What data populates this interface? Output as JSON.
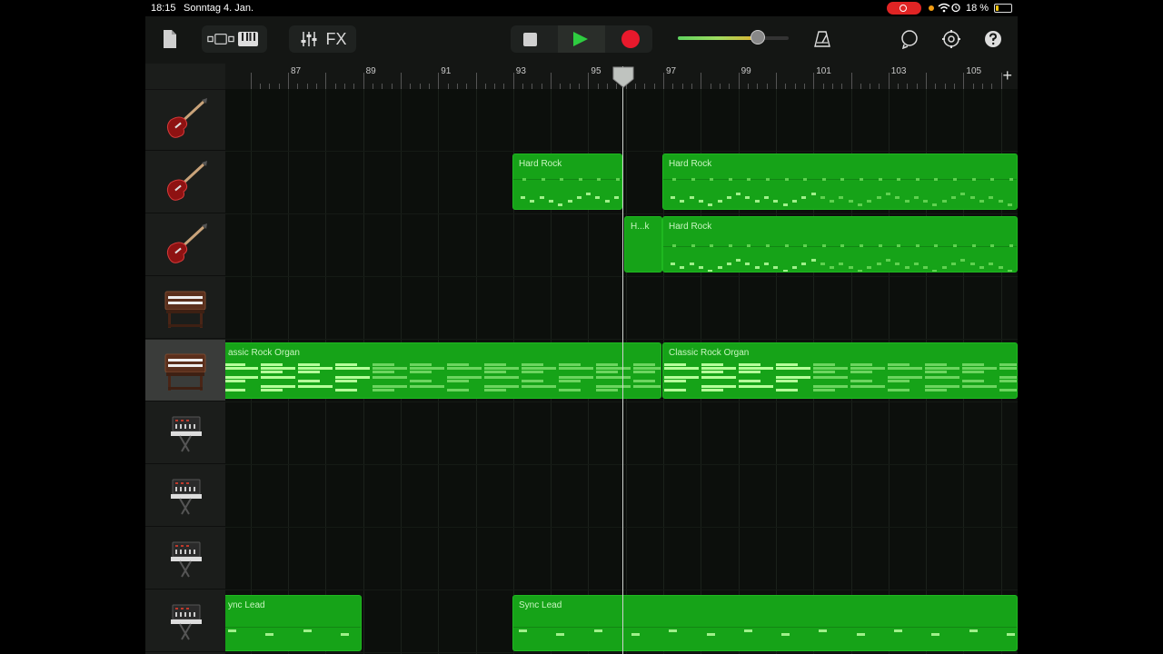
{
  "status_bar": {
    "time": "18:15",
    "date": "Sonntag 4. Jan.",
    "battery_text": "18 %",
    "battery_level": 0.18
  },
  "toolbar": {
    "fx_label": "FX",
    "volume_level": 0.72,
    "icons": [
      "document-icon",
      "view-toggle-icon",
      "keyboard-icon",
      "mixer-icon",
      "fx",
      "stop-icon",
      "play-icon",
      "record-icon",
      "metronome-icon",
      "loop-icon",
      "settings-icon",
      "help-icon"
    ]
  },
  "ruler": {
    "bars": [
      "87",
      "89",
      "91",
      "93",
      "95",
      "97",
      "99",
      "101",
      "103",
      "105"
    ],
    "add_label": "+"
  },
  "tracks": [
    {
      "instrument": "electric-guitar-icon"
    },
    {
      "instrument": "electric-guitar-icon"
    },
    {
      "instrument": "electric-guitar-icon"
    },
    {
      "instrument": "organ-icon"
    },
    {
      "instrument": "organ-icon",
      "selected": true
    },
    {
      "instrument": "synth-icon"
    },
    {
      "instrument": "synth-icon"
    },
    {
      "instrument": "synth-icon"
    },
    {
      "instrument": "synth-icon"
    }
  ],
  "regions": {
    "hard_rock_1": "Hard Rock",
    "hard_rock_2": "Hard Rock",
    "hk_short": "H...k",
    "hard_rock_3": "Hard Rock",
    "organ_1": "assic Rock Organ",
    "organ_2": "Classic Rock Organ",
    "sync_1": "ync Lead",
    "sync_2": "Sync Lead"
  },
  "colors": {
    "region_green": "#16a318",
    "record_red": "#e8192c",
    "play_green": "#2ecc40"
  }
}
